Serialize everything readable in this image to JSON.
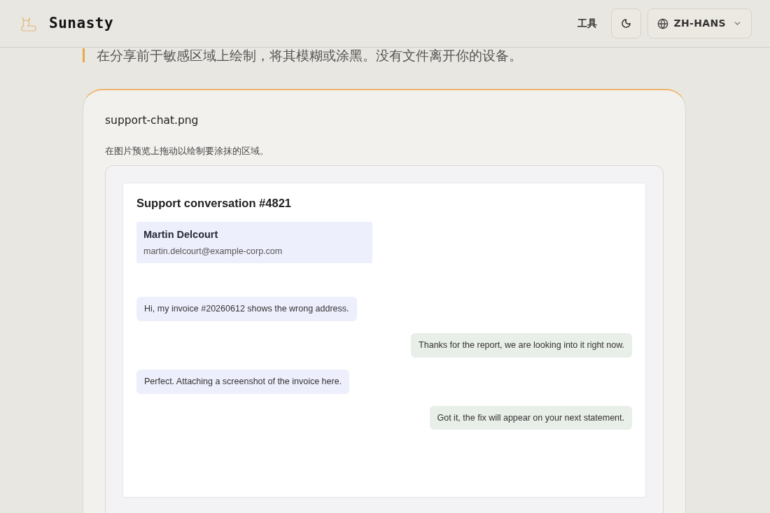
{
  "header": {
    "brand": "Sunasty",
    "nav_link": "工具",
    "language": "ZH-HANS"
  },
  "intro": "在分享前于敏感区域上绘制，将其模糊或涂黑。没有文件离开你的设备。",
  "card": {
    "filename": "support-chat.png",
    "hint": "在图片预览上拖动以绘制要涂抹的区域。",
    "preview": {
      "title": "Support conversation #4821",
      "contact": {
        "name": "Martin Delcourt",
        "email": "martin.delcourt@example-corp.com"
      },
      "messages": [
        {
          "kind": "incoming",
          "text": "Hi, my invoice #20260612 shows the wrong address."
        },
        {
          "kind": "outgoing",
          "text": "Thanks for the report, we are looking into it right now."
        },
        {
          "kind": "incoming",
          "text": "Perfect. Attaching a screenshot of the invoice here."
        },
        {
          "kind": "outgoing",
          "text": "Got it, the fix will appear on your next statement."
        }
      ]
    }
  }
}
